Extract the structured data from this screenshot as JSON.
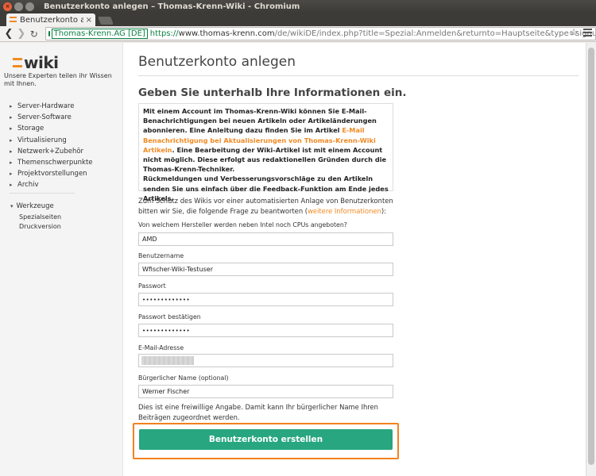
{
  "window": {
    "title": "Benutzerkonto anlegen – Thomas-Krenn-Wiki - Chromium"
  },
  "tab": {
    "title": "Benutzerkonto anle",
    "close": "×"
  },
  "address": {
    "ev_label": "Thomas-Krenn.AG [DE]",
    "scheme": "https://",
    "host": "www.thomas-krenn.com",
    "path": "/de/wikiDE/index.php?title=Spezial:Anmelden&returnto=Hauptseite&type=signup"
  },
  "icons": {
    "back": "❮",
    "forward": "❯",
    "reload": "↻",
    "star": "☆"
  },
  "sidebar": {
    "logo_text": "wiki",
    "tagline": "Unsere Experten teilen ihr Wissen mit Ihnen.",
    "nav_items": [
      "Server-Hardware",
      "Server-Software",
      "Storage",
      "Virtualisierung",
      "Netzwerk+Zubehör",
      "Themenschwerpunkte",
      "Projektvorstellungen",
      "Archiv"
    ],
    "tools_heading": "Werkzeuge",
    "tools_items": [
      "Spezialseiten",
      "Druckversion"
    ]
  },
  "content": {
    "page_title": "Benutzerkonto anlegen",
    "subheading": "Geben Sie unterhalb Ihre Informationen ein.",
    "info_part1": "Mit einem Account im Thomas-Krenn-Wiki können Sie E-Mail-Benachrichtigungen bei neuen Artikeln oder Artikeländerungen abonnieren. Eine Anleitung dazu finden Sie im Artikel ",
    "info_link": "E-Mail Benachrichtigung bei Aktualisierungen von Thomas-Krenn-Wiki Artikeln",
    "info_part2": ". Eine Bearbeitung der Wiki-Artikel ist mit einem Account nicht möglich. Diese erfolgt aus redaktionellen Gründen durch die Thomas-Krenn-Techniker.",
    "info_part3": "Rückmeldungen und Verbesserungsvorschläge zu den Artikeln senden Sie uns einfach über die Feedback-Funktion am Ende jedes Artikels.",
    "intro_text": "Zum Schutz des Wikis vor einer automatisierten Anlage von Benutzerkonten bitten wir Sie, die folgende Frage zu beantworten (",
    "intro_link": "weitere Informationen",
    "intro_end": "):",
    "hint": "Dies ist eine freiwillige Angabe. Damit kann Ihr bürgerlicher Name Ihren Beiträgen zugeordnet werden.",
    "submit_label": "Benutzerkonto erstellen"
  },
  "form": {
    "question_label": "Von welchem Hersteller werden neben Intel noch CPUs angeboten?",
    "question_value": "AMD",
    "username_label": "Benutzername",
    "username_value": "Wfischer-Wiki-Testuser",
    "password_label": "Passwort",
    "password_value": "•••••••••••••",
    "password_confirm_label": "Passwort bestätigen",
    "password_confirm_value": "•••••••••••••",
    "email_label": "E-Mail-Adresse",
    "email_value": "",
    "realname_label": "Bürgerlicher Name (optional)",
    "realname_value": "Werner Fischer"
  },
  "colors": {
    "accent_orange": "#f08a24",
    "button_green": "#27a67f",
    "highlight_orange": "#f48120",
    "secure_green": "#0b8043"
  }
}
